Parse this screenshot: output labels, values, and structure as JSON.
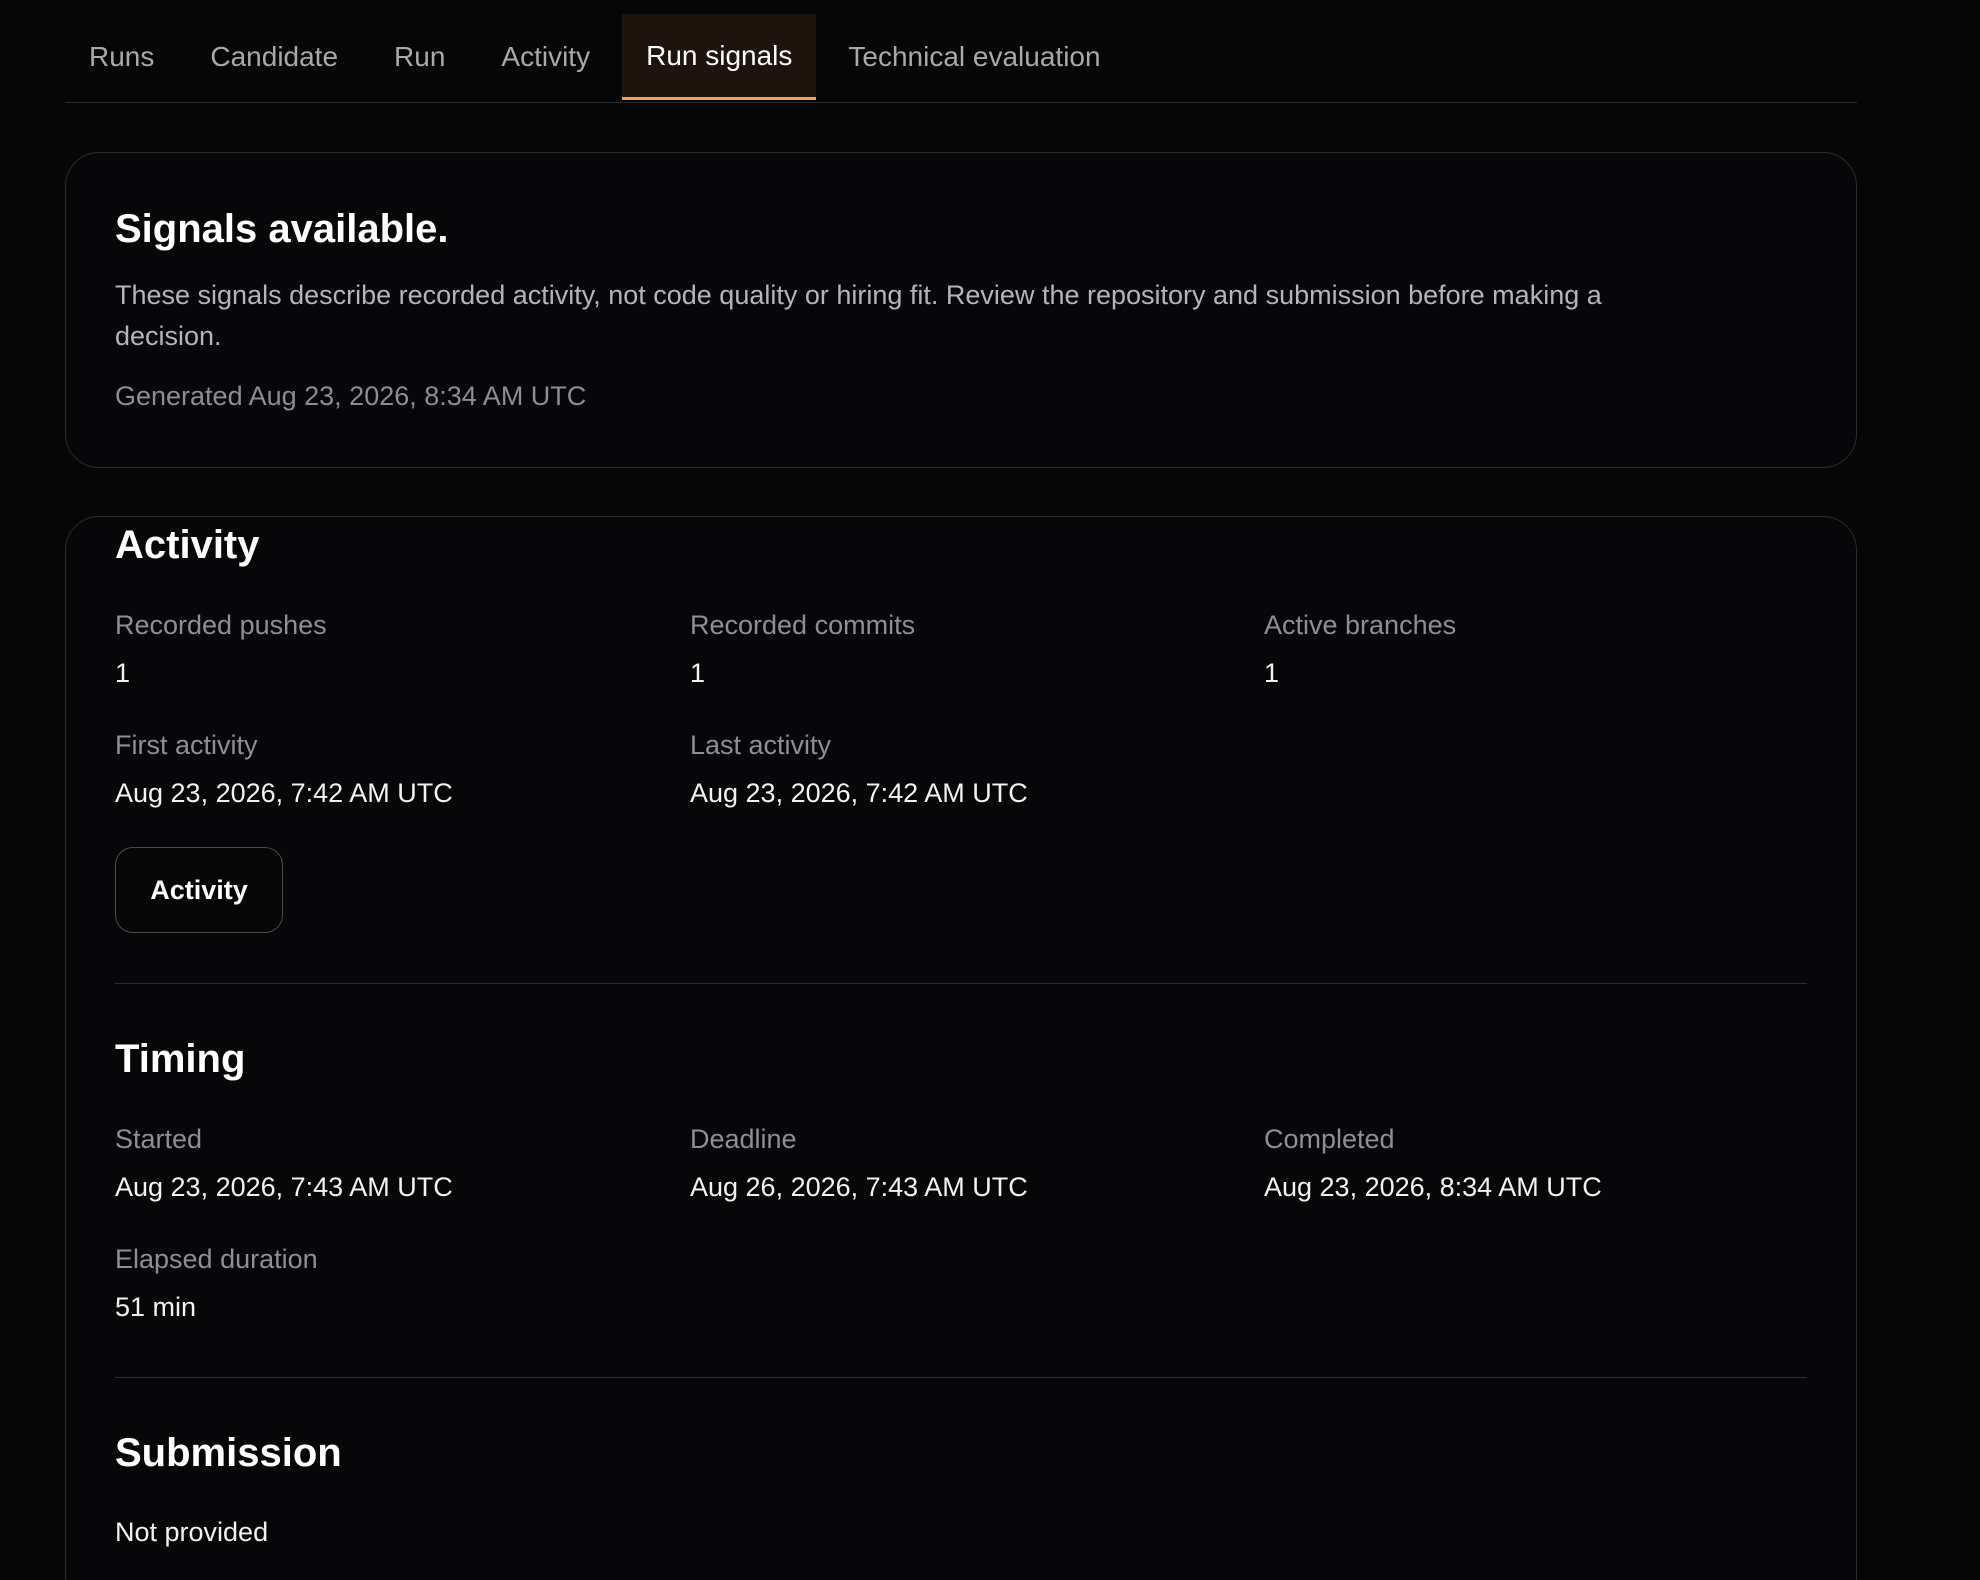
{
  "tabs": [
    {
      "label": "Runs"
    },
    {
      "label": "Candidate"
    },
    {
      "label": "Run"
    },
    {
      "label": "Activity"
    },
    {
      "label": "Run signals",
      "active": true
    },
    {
      "label": "Technical evaluation"
    }
  ],
  "summary": {
    "title": "Signals available.",
    "description": "These signals describe recorded activity, not code quality or hiring fit. Review the repository and submission before making a decision.",
    "generated": "Generated Aug 23, 2026, 8:34 AM UTC"
  },
  "activity": {
    "title": "Activity",
    "recorded_pushes": {
      "label": "Recorded pushes",
      "value": "1"
    },
    "recorded_commits": {
      "label": "Recorded commits",
      "value": "1"
    },
    "active_branches": {
      "label": "Active branches",
      "value": "1"
    },
    "first_activity": {
      "label": "First activity",
      "value": "Aug 23, 2026, 7:42 AM UTC"
    },
    "last_activity": {
      "label": "Last activity",
      "value": "Aug 23, 2026, 7:42 AM UTC"
    },
    "button_label": "Activity"
  },
  "timing": {
    "title": "Timing",
    "started": {
      "label": "Started",
      "value": "Aug 23, 2026, 7:43 AM UTC"
    },
    "deadline": {
      "label": "Deadline",
      "value": "Aug 26, 2026, 7:43 AM UTC"
    },
    "completed": {
      "label": "Completed",
      "value": "Aug 23, 2026, 8:34 AM UTC"
    },
    "elapsed": {
      "label": "Elapsed duration",
      "value": "51 min"
    }
  },
  "submission": {
    "title": "Submission",
    "value": "Not provided"
  },
  "colors": {
    "background": "#060607",
    "accent": "#f0a35e",
    "active_tab_bg": "#1e140d"
  }
}
